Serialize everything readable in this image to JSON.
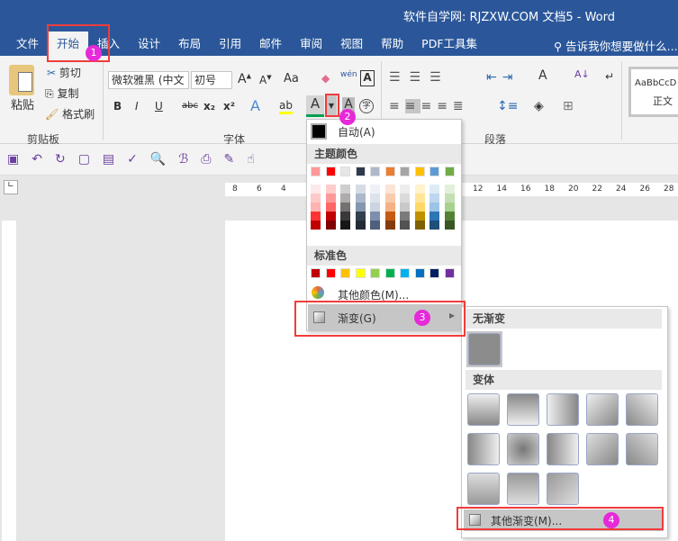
{
  "window": {
    "title": "软件自学网: RJZXW.COM  文档5  -  Word"
  },
  "tabs": [
    "文件",
    "开始",
    "插入",
    "设计",
    "布局",
    "引用",
    "邮件",
    "审阅",
    "视图",
    "帮助",
    "PDF工具集"
  ],
  "tell_me": "告诉我你想要做什么...",
  "clipboard": {
    "paste": "粘贴",
    "cut": "剪切",
    "copy": "复制",
    "format_painter": "格式刷",
    "group": "剪贴板"
  },
  "font": {
    "name": "微软雅黑 (中文",
    "size": "初号",
    "group": "字体",
    "case": "Aa",
    "bold": "B",
    "italic": "I",
    "underline": "U",
    "strike": "abc",
    "sub": "x₂",
    "sup": "x²",
    "phonetic": "wén",
    "enclose": "字"
  },
  "paragraph": {
    "group": "段落"
  },
  "styles": {
    "preview": "AaBbCcD",
    "name": "正文"
  },
  "ruler": [
    "8",
    "6",
    "4",
    "12",
    "14",
    "16",
    "18",
    "20",
    "22",
    "24",
    "26",
    "28"
  ],
  "color_menu": {
    "auto": "自动(A)",
    "theme_header": "主题颜色",
    "standard_header": "标准色",
    "more": "其他颜色(M)...",
    "gradient": "渐变(G)",
    "theme_top": [
      "#ff9999",
      "#ff0000",
      "#e7e6e6",
      "#2e3a4e",
      "#acb9ca",
      "#ed7d31",
      "#a5a5a5",
      "#ffc000",
      "#5b9bd5",
      "#70ad47"
    ],
    "theme_shades": [
      [
        "#fde9e9",
        "#ffc9c9",
        "#ffb3b3",
        "#ff3333",
        "#c00000"
      ],
      [
        "#ffcccc",
        "#ff9999",
        "#ff6666",
        "#c00000",
        "#800000"
      ],
      [
        "#d0cece",
        "#aeabab",
        "#757171",
        "#3a3838",
        "#171616"
      ],
      [
        "#d6dce4",
        "#adb9ca",
        "#8497b0",
        "#323f4f",
        "#222a35"
      ],
      [
        "#eef1f5",
        "#dde3eb",
        "#cbd4e0",
        "#7e8fad",
        "#4f5f7c"
      ],
      [
        "#fbe5d6",
        "#f8cbad",
        "#f4b183",
        "#c55a11",
        "#843c0c"
      ],
      [
        "#ededed",
        "#dbdbdb",
        "#c9c9c9",
        "#7b7b7b",
        "#525252"
      ],
      [
        "#fff2cc",
        "#ffe699",
        "#ffd966",
        "#bf9000",
        "#7f6000"
      ],
      [
        "#deebf7",
        "#bdd7ee",
        "#9dc3e6",
        "#2e75b6",
        "#1f4e79"
      ],
      [
        "#e2f0d9",
        "#c5e0b4",
        "#a9d18e",
        "#548235",
        "#385723"
      ]
    ],
    "standard": [
      "#c00000",
      "#ff0000",
      "#ffc000",
      "#ffff00",
      "#92d050",
      "#00b050",
      "#00b0f0",
      "#0070c0",
      "#002060",
      "#7030a0"
    ]
  },
  "gradient_menu": {
    "none_header": "无渐变",
    "variants_header": "变体",
    "more": "其他渐变(M)..."
  },
  "badges": [
    "1",
    "2",
    "3",
    "4"
  ]
}
